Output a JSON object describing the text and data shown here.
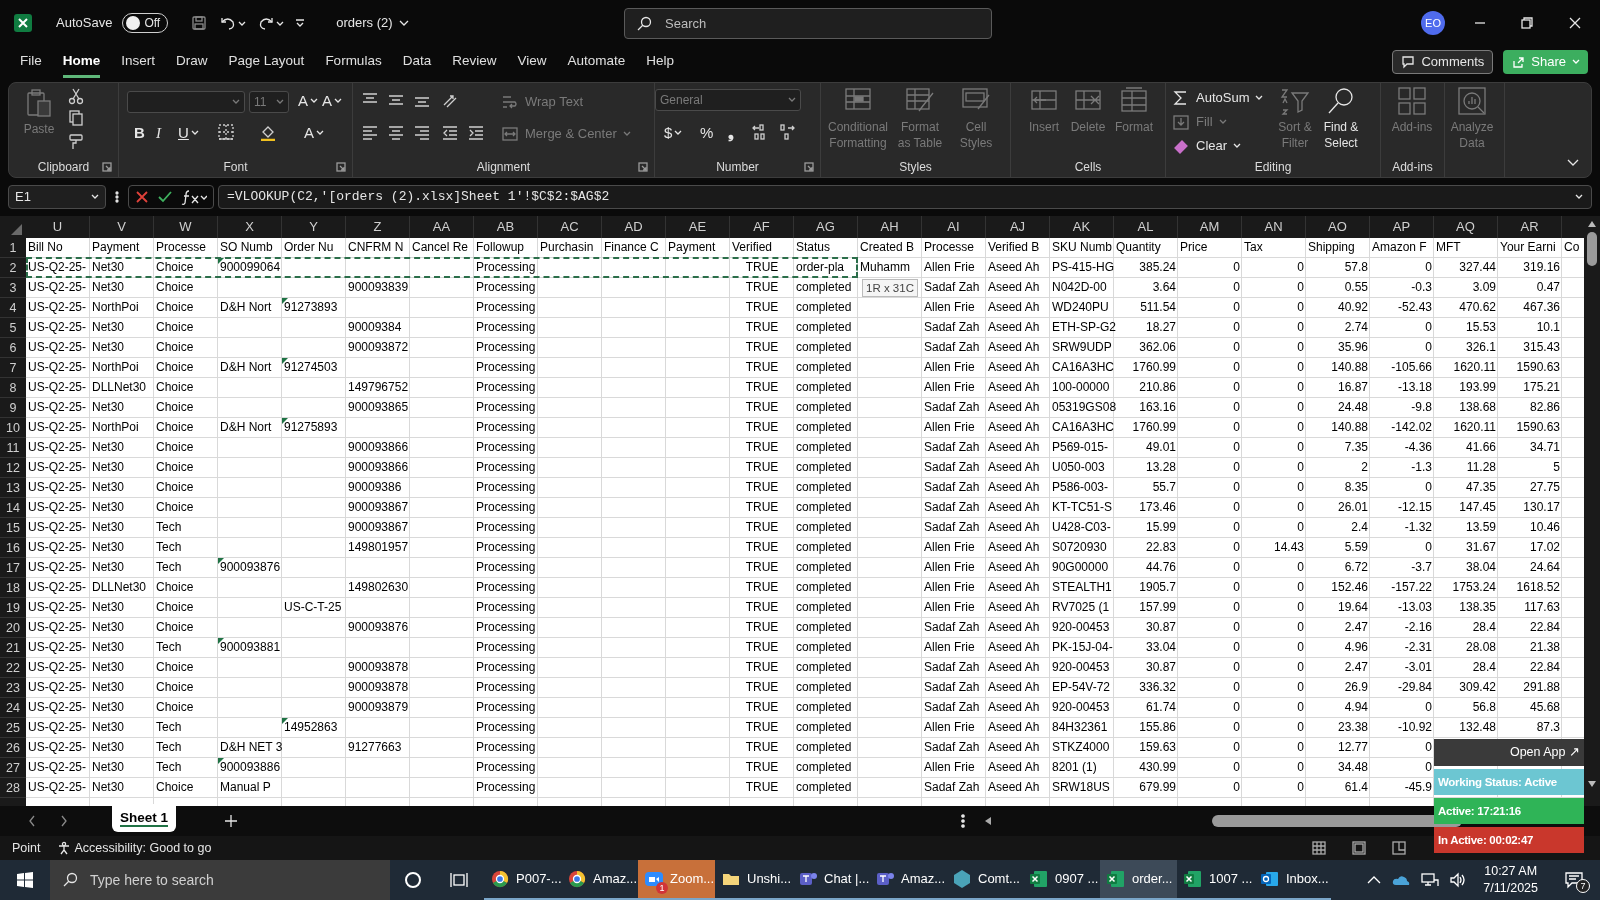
{
  "title_bar": {
    "autosave_label": "AutoSave",
    "autosave": {
      "label": "Off",
      "on": false
    },
    "file_name": "orders (2)",
    "search_placeholder": "Search",
    "avatar": "EO"
  },
  "tabs": [
    {
      "label": "File",
      "selected": false
    },
    {
      "label": "Home",
      "selected": true
    },
    {
      "label": "Insert",
      "selected": false
    },
    {
      "label": "Draw",
      "selected": false
    },
    {
      "label": "Page Layout",
      "selected": false
    },
    {
      "label": "Formulas",
      "selected": false
    },
    {
      "label": "Data",
      "selected": false
    },
    {
      "label": "Review",
      "selected": false
    },
    {
      "label": "View",
      "selected": false
    },
    {
      "label": "Automate",
      "selected": false
    },
    {
      "label": "Help",
      "selected": false
    }
  ],
  "header_buttons": [
    {
      "kind": "comments",
      "label": "Comments"
    },
    {
      "kind": "share",
      "label": "Share"
    }
  ],
  "ribbon": [
    {
      "label": "Clipboard",
      "launcher": true,
      "items": [
        {
          "kind": "paste",
          "label": "Paste",
          "disabled": true
        },
        {
          "kind": "cut"
        },
        {
          "kind": "copy"
        },
        {
          "kind": "painter"
        }
      ]
    },
    {
      "label": "Font",
      "launcher": true,
      "items": [
        {
          "kind": "fontname",
          "disabled": true
        },
        {
          "kind": "fontsize",
          "label": "11",
          "disabled": true
        },
        {
          "kind": "grow",
          "label": "A"
        },
        {
          "kind": "shrink",
          "label": "A"
        },
        {
          "kind": "bold",
          "label": "B"
        },
        {
          "kind": "italic",
          "label": "I"
        },
        {
          "kind": "underline",
          "label": "U"
        },
        {
          "kind": "borders"
        },
        {
          "kind": "fill"
        },
        {
          "kind": "fontcolor",
          "label": "A"
        }
      ]
    },
    {
      "label": "Alignment",
      "launcher": true,
      "items": [
        {
          "kind": "aligntop"
        },
        {
          "kind": "alignmiddle"
        },
        {
          "kind": "alignbottom"
        },
        {
          "kind": "orientation"
        },
        {
          "kind": "wrap",
          "label": "Wrap Text",
          "disabled": true
        },
        {
          "kind": "alignleft"
        },
        {
          "kind": "aligncenter"
        },
        {
          "kind": "alignright"
        },
        {
          "kind": "outdent"
        },
        {
          "kind": "indent"
        },
        {
          "kind": "merge",
          "label": "Merge & Center",
          "disabled": true
        }
      ]
    },
    {
      "label": "Number",
      "launcher": true,
      "items": [
        {
          "kind": "format",
          "label": "General",
          "disabled": true
        },
        {
          "kind": "dollar",
          "label": "$"
        },
        {
          "kind": "percent",
          "label": "%"
        },
        {
          "kind": "comma",
          "label": "❟"
        },
        {
          "kind": "decmore"
        },
        {
          "kind": "decless"
        }
      ]
    },
    {
      "label": "Styles",
      "launcher": false,
      "items": [
        {
          "kind": "conditional",
          "label": "Conditional Formatting",
          "disabled": true
        },
        {
          "kind": "astable",
          "label": "Format as Table",
          "disabled": true
        },
        {
          "kind": "cellstyles",
          "label": "Cell Styles",
          "disabled": true
        }
      ]
    },
    {
      "label": "Cells",
      "launcher": false,
      "items": [
        {
          "kind": "insert",
          "label": "Insert",
          "disabled": true
        },
        {
          "kind": "delete",
          "label": "Delete",
          "disabled": true
        },
        {
          "kind": "cellformat",
          "label": "Format",
          "disabled": true
        }
      ]
    },
    {
      "label": "Editing",
      "launcher": false,
      "items": [
        {
          "kind": "autosum",
          "label": "AutoSum",
          "disabled": false
        },
        {
          "kind": "filldown",
          "label": "Fill",
          "disabled": true
        },
        {
          "kind": "clear",
          "label": "Clear",
          "disabled": false
        },
        {
          "kind": "sort",
          "label": "Sort & Filter",
          "disabled": true
        },
        {
          "kind": "find",
          "label": "Find & Select",
          "disabled": false
        }
      ]
    },
    {
      "label": "Add-ins",
      "launcher": false,
      "items": [
        {
          "kind": "addins",
          "label": "Add-ins",
          "disabled": true
        }
      ]
    },
    {
      "items": [
        {
          "kind": "analyze",
          "label": "Analyze Data",
          "disabled": true
        }
      ]
    }
  ],
  "formula_bar": {
    "name_box": "E1",
    "formula": "=VLOOKUP(C2,'[orders (2).xlsx]Sheet 1'!$C$2:$AG$2"
  },
  "columns": [
    {
      "letter": "U",
      "kind": "text"
    },
    {
      "letter": "V",
      "kind": "text"
    },
    {
      "letter": "W",
      "kind": "text"
    },
    {
      "letter": "X",
      "kind": "text"
    },
    {
      "letter": "Y",
      "kind": "text"
    },
    {
      "letter": "Z",
      "kind": "text"
    },
    {
      "letter": "AA",
      "kind": "text"
    },
    {
      "letter": "AB",
      "kind": "text"
    },
    {
      "letter": "AC",
      "kind": "text"
    },
    {
      "letter": "AD",
      "kind": "text"
    },
    {
      "letter": "AE",
      "kind": "text"
    },
    {
      "letter": "AF",
      "kind": "boolean"
    },
    {
      "letter": "AG",
      "kind": "text"
    },
    {
      "letter": "AH",
      "kind": "text"
    },
    {
      "letter": "AI",
      "kind": "text"
    },
    {
      "letter": "AJ",
      "kind": "text"
    },
    {
      "letter": "AK",
      "kind": "text"
    },
    {
      "letter": "AL",
      "kind": "number"
    },
    {
      "letter": "AM",
      "kind": "number"
    },
    {
      "letter": "AN",
      "kind": "number"
    },
    {
      "letter": "AO",
      "kind": "number"
    },
    {
      "letter": "AP",
      "kind": "number"
    },
    {
      "letter": "AQ",
      "kind": "number"
    },
    {
      "letter": "AR",
      "kind": "number"
    }
  ],
  "rows": [
    {
      "number": "1",
      "kind": "header",
      "copied": false,
      "cells": [
        "Bill No",
        "Payment",
        "Processe",
        "SO Numb",
        "Order Nu",
        "CNFRM N",
        "Cancel Re",
        "Followup",
        "Purchasin",
        "Finance C",
        "Payment",
        "Verified",
        "Status",
        "Created B",
        "Processe",
        "Verified B",
        "SKU Numb",
        "Quantity",
        "Price",
        "Tax",
        "Shipping",
        "Amazon F",
        "MFT",
        "Your Earni",
        "Co"
      ]
    },
    {
      "number": "2",
      "kind": "data",
      "copied": true,
      "cells": [
        "US-Q2-25-",
        "Net30",
        "Choice",
        {
          "text": "900099064",
          "flag": true
        },
        null,
        null,
        null,
        "Processing",
        null,
        null,
        null,
        "TRUE",
        "order-pla",
        "Muhamm",
        "Allen Frie",
        "Aseed Ah",
        "PS-415-HG",
        "385.24",
        "0",
        "0",
        "57.8",
        "0",
        "327.44",
        "319.16"
      ]
    },
    {
      "number": "3",
      "kind": "data",
      "copied": false,
      "cells": [
        "US-Q2-25-",
        "Net30",
        "Choice",
        null,
        null,
        "900093839",
        null,
        "Processing",
        null,
        null,
        null,
        "TRUE",
        "completed",
        null,
        "Sadaf Zah",
        "Aseed Ah",
        "N042D-00",
        "3.64",
        "0",
        "0",
        "0.55",
        "-0.3",
        "3.09",
        "0.47"
      ]
    },
    {
      "number": "4",
      "kind": "data",
      "copied": false,
      "cells": [
        "US-Q2-25-",
        "NorthPoi",
        "Choice",
        "D&H Nort",
        {
          "text": "91273893",
          "flag": true
        },
        null,
        null,
        "Processing",
        null,
        null,
        null,
        "TRUE",
        "completed",
        null,
        "Allen Frie",
        "Aseed Ah",
        "WD240PU",
        "511.54",
        "0",
        "0",
        "40.92",
        "-52.43",
        "470.62",
        "467.36"
      ]
    },
    {
      "number": "5",
      "kind": "data",
      "copied": false,
      "cells": [
        "US-Q2-25-",
        "Net30",
        "Choice",
        null,
        null,
        "90009384",
        null,
        "Processing",
        null,
        null,
        null,
        "TRUE",
        "completed",
        null,
        "Sadaf Zah",
        "Aseed Ah",
        "ETH-SP-G2",
        "18.27",
        "0",
        "0",
        "2.74",
        "0",
        "15.53",
        "10.1"
      ]
    },
    {
      "number": "6",
      "kind": "data",
      "copied": false,
      "cells": [
        "US-Q2-25-",
        "Net30",
        "Choice",
        null,
        null,
        "900093872",
        null,
        "Processing",
        null,
        null,
        null,
        "TRUE",
        "completed",
        null,
        "Sadaf Zah",
        "Aseed Ah",
        "SRW9UDP",
        "362.06",
        "0",
        "0",
        "35.96",
        "0",
        "326.1",
        "315.43"
      ]
    },
    {
      "number": "7",
      "kind": "data",
      "copied": false,
      "cells": [
        "US-Q2-25-",
        "NorthPoi",
        "Choice",
        "D&H Nort",
        {
          "text": "91274503",
          "flag": true
        },
        null,
        null,
        "Processing",
        null,
        null,
        null,
        "TRUE",
        "completed",
        null,
        "Allen Frie",
        "Aseed Ah",
        "CA16A3HC",
        "1760.99",
        "0",
        "0",
        "140.88",
        "-105.66",
        "1620.11",
        "1590.63"
      ]
    },
    {
      "number": "8",
      "kind": "data",
      "copied": false,
      "cells": [
        "US-Q2-25-",
        "DLLNet30",
        "Choice",
        null,
        null,
        "149796752",
        null,
        "Processing",
        null,
        null,
        null,
        "TRUE",
        "completed",
        null,
        "Allen Frie",
        "Aseed Ah",
        "100-00000",
        "210.86",
        "0",
        "0",
        "16.87",
        "-13.18",
        "193.99",
        "175.21"
      ]
    },
    {
      "number": "9",
      "kind": "data",
      "copied": false,
      "cells": [
        "US-Q2-25-",
        "Net30",
        "Choice",
        null,
        null,
        "900093865",
        null,
        "Processing",
        null,
        null,
        null,
        "TRUE",
        "completed",
        null,
        "Sadaf Zah",
        "Aseed Ah",
        "05319GS08",
        "163.16",
        "0",
        "0",
        "24.48",
        "-9.8",
        "138.68",
        "82.86"
      ]
    },
    {
      "number": "10",
      "kind": "data",
      "copied": false,
      "cells": [
        "US-Q2-25-",
        "NorthPoi",
        "Choice",
        "D&H Nort",
        {
          "text": "91275893",
          "flag": true
        },
        null,
        null,
        "Processing",
        null,
        null,
        null,
        "TRUE",
        "completed",
        null,
        "Allen Frie",
        "Aseed Ah",
        "CA16A3HC",
        "1760.99",
        "0",
        "0",
        "140.88",
        "-142.02",
        "1620.11",
        "1590.63"
      ]
    },
    {
      "number": "11",
      "kind": "data",
      "copied": false,
      "cells": [
        "US-Q2-25-",
        "Net30",
        "Choice",
        null,
        null,
        "900093866",
        null,
        "Processing",
        null,
        null,
        null,
        "TRUE",
        "completed",
        null,
        "Sadaf Zah",
        "Aseed Ah",
        "P569-015-",
        "49.01",
        "0",
        "0",
        "7.35",
        "-4.36",
        "41.66",
        "34.71"
      ]
    },
    {
      "number": "12",
      "kind": "data",
      "copied": false,
      "cells": [
        "US-Q2-25-",
        "Net30",
        "Choice",
        null,
        null,
        "900093866",
        null,
        "Processing",
        null,
        null,
        null,
        "TRUE",
        "completed",
        null,
        "Sadaf Zah",
        "Aseed Ah",
        "U050-003",
        "13.28",
        "0",
        "0",
        "2",
        "-1.3",
        "11.28",
        "5"
      ]
    },
    {
      "number": "13",
      "kind": "data",
      "copied": false,
      "cells": [
        "US-Q2-25-",
        "Net30",
        "Choice",
        null,
        null,
        "90009386",
        null,
        "Processing",
        null,
        null,
        null,
        "TRUE",
        "completed",
        null,
        "Sadaf Zah",
        "Aseed Ah",
        "P586-003-",
        "55.7",
        "0",
        "0",
        "8.35",
        "0",
        "47.35",
        "27.75"
      ]
    },
    {
      "number": "14",
      "kind": "data",
      "copied": false,
      "cells": [
        "US-Q2-25-",
        "Net30",
        "Choice",
        null,
        null,
        "900093867",
        null,
        "Processing",
        null,
        null,
        null,
        "TRUE",
        "completed",
        null,
        "Sadaf Zah",
        "Aseed Ah",
        "KT-TC51-S",
        "173.46",
        "0",
        "0",
        "26.01",
        "-12.15",
        "147.45",
        "130.17"
      ]
    },
    {
      "number": "15",
      "kind": "data",
      "copied": false,
      "cells": [
        "US-Q2-25-",
        "Net30",
        "Tech",
        null,
        null,
        "900093867",
        null,
        "Processing",
        null,
        null,
        null,
        "TRUE",
        "completed",
        null,
        "Sadaf Zah",
        "Aseed Ah",
        "U428-C03-",
        "15.99",
        "0",
        "0",
        "2.4",
        "-1.32",
        "13.59",
        "10.46"
      ]
    },
    {
      "number": "16",
      "kind": "data",
      "copied": false,
      "cells": [
        "US-Q2-25-",
        "Net30",
        "Tech",
        null,
        null,
        "149801957",
        null,
        "Processing",
        null,
        null,
        null,
        "TRUE",
        "completed",
        null,
        "Allen Frie",
        "Aseed Ah",
        "S0720930",
        "22.83",
        "0",
        "14.43",
        "5.59",
        "0",
        "31.67",
        "17.02"
      ]
    },
    {
      "number": "17",
      "kind": "data",
      "copied": false,
      "cells": [
        "US-Q2-25-",
        "Net30",
        "Tech",
        {
          "text": "900093876",
          "flag": true
        },
        null,
        null,
        null,
        "Processing",
        null,
        null,
        null,
        "TRUE",
        "completed",
        null,
        "Allen Frie",
        "Aseed Ah",
        "90G00000",
        "44.76",
        "0",
        "0",
        "6.72",
        "-3.7",
        "38.04",
        "24.64"
      ]
    },
    {
      "number": "18",
      "kind": "data",
      "copied": false,
      "cells": [
        "US-Q2-25-",
        "DLLNet30",
        "Choice",
        null,
        null,
        "149802630",
        null,
        "Processing",
        null,
        null,
        null,
        "TRUE",
        "completed",
        null,
        "Allen Frie",
        "Aseed Ah",
        "STEALTH1",
        "1905.7",
        "0",
        "0",
        "152.46",
        "-157.22",
        "1753.24",
        "1618.52"
      ]
    },
    {
      "number": "19",
      "kind": "data",
      "copied": false,
      "cells": [
        "US-Q2-25-",
        "Net30",
        "Choice",
        null,
        "US-C-T-25",
        null,
        null,
        "Processing",
        null,
        null,
        null,
        "TRUE",
        "completed",
        null,
        "Allen Frie",
        "Aseed Ah",
        "RV7025 (1",
        "157.99",
        "0",
        "0",
        "19.64",
        "-13.03",
        "138.35",
        "117.63"
      ]
    },
    {
      "number": "20",
      "kind": "data",
      "copied": false,
      "cells": [
        "US-Q2-25-",
        "Net30",
        "Choice",
        null,
        null,
        "900093876",
        null,
        "Processing",
        null,
        null,
        null,
        "TRUE",
        "completed",
        null,
        "Sadaf Zah",
        "Aseed Ah",
        "920-00453",
        "30.87",
        "0",
        "0",
        "2.47",
        "-2.16",
        "28.4",
        "22.84"
      ]
    },
    {
      "number": "21",
      "kind": "data",
      "copied": false,
      "cells": [
        "US-Q2-25-",
        "Net30",
        "Tech",
        {
          "text": "900093881",
          "flag": true
        },
        null,
        null,
        null,
        "Processing",
        null,
        null,
        null,
        "TRUE",
        "completed",
        null,
        "Allen Frie",
        "Aseed Ah",
        "PK-15J-04-",
        "33.04",
        "0",
        "0",
        "4.96",
        "-2.31",
        "28.08",
        "21.38"
      ]
    },
    {
      "number": "22",
      "kind": "data",
      "copied": false,
      "cells": [
        "US-Q2-25-",
        "Net30",
        "Choice",
        null,
        null,
        "900093878",
        null,
        "Processing",
        null,
        null,
        null,
        "TRUE",
        "completed",
        null,
        "Sadaf Zah",
        "Aseed Ah",
        "920-00453",
        "30.87",
        "0",
        "0",
        "2.47",
        "-3.01",
        "28.4",
        "22.84"
      ]
    },
    {
      "number": "23",
      "kind": "data",
      "copied": false,
      "cells": [
        "US-Q2-25-",
        "Net30",
        "Choice",
        null,
        null,
        "900093878",
        null,
        "Processing",
        null,
        null,
        null,
        "TRUE",
        "completed",
        null,
        "Sadaf Zah",
        "Aseed Ah",
        "EP-54V-72",
        "336.32",
        "0",
        "0",
        "26.9",
        "-29.84",
        "309.42",
        "291.88"
      ]
    },
    {
      "number": "24",
      "kind": "data",
      "copied": false,
      "cells": [
        "US-Q2-25-",
        "Net30",
        "Choice",
        null,
        null,
        "900093879",
        null,
        "Processing",
        null,
        null,
        null,
        "TRUE",
        "completed",
        null,
        "Sadaf Zah",
        "Aseed Ah",
        "920-00453",
        "61.74",
        "0",
        "0",
        "4.94",
        "0",
        "56.8",
        "45.68"
      ]
    },
    {
      "number": "25",
      "kind": "data",
      "copied": false,
      "cells": [
        "US-Q2-25-",
        "Net30",
        "Tech",
        null,
        {
          "text": "14952863",
          "flag": true
        },
        null,
        null,
        "Processing",
        null,
        null,
        null,
        "TRUE",
        "completed",
        null,
        "Allen Frie",
        "Aseed Ah",
        "84H32361",
        "155.86",
        "0",
        "0",
        "23.38",
        "-10.92",
        "132.48",
        "87.3"
      ]
    },
    {
      "number": "26",
      "kind": "data",
      "copied": false,
      "cells": [
        "US-Q2-25-",
        "Net30",
        "Tech",
        "D&H NET 3",
        null,
        "91277663",
        null,
        "Processing",
        null,
        null,
        null,
        "TRUE",
        "completed",
        null,
        "Sadaf Zah",
        "Aseed Ah",
        "STKZ4000",
        "159.63",
        "0",
        "0",
        "12.77",
        "0",
        null,
        null
      ]
    },
    {
      "number": "27",
      "kind": "data",
      "copied": false,
      "cells": [
        "US-Q2-25-",
        "Net30",
        "Tech",
        {
          "text": "900093886",
          "flag": true
        },
        null,
        null,
        null,
        "Processing",
        null,
        null,
        null,
        "TRUE",
        "completed",
        null,
        "Allen Frie",
        "Aseed Ah",
        "8201 (1)",
        "430.99",
        "0",
        "0",
        "34.48",
        "0",
        null,
        null
      ]
    },
    {
      "number": "28",
      "kind": "data",
      "copied": false,
      "cells": [
        "US-Q2-25-",
        "Net30",
        "Choice",
        "Manual P",
        null,
        null,
        null,
        "Processing",
        null,
        null,
        null,
        "TRUE",
        "completed",
        null,
        "Sadaf Zah",
        "Aseed Ah",
        "SRW18US",
        "679.99",
        "0",
        "0",
        "61.4",
        "-45.9",
        null,
        null
      ]
    }
  ],
  "selection_tooltip": "1R x 31C",
  "sheet_tabs": [
    {
      "label": "Sheet 1",
      "selected": true
    }
  ],
  "status_bar": {
    "mode": "Point",
    "accessibility": "Accessibility: Good to go"
  },
  "tracker": {
    "open_app": "Open App ↗",
    "statuses": [
      {
        "label": "Working Status: Active",
        "color": "#6cc6d2"
      },
      {
        "label": "Active: 17:21:16",
        "color": "#2fb457"
      },
      {
        "label": "In Active: 00:02:47",
        "color": "#c9372c"
      }
    ]
  },
  "taskbar": {
    "search_placeholder": "Type here to search",
    "apps": [
      {
        "label": "P007-...",
        "kind": "chrome",
        "selected": false
      },
      {
        "label": "Amaz...",
        "kind": "chrome",
        "selected": false
      },
      {
        "label": "Zoom...",
        "kind": "zoom",
        "selected": false,
        "badge": "1"
      },
      {
        "label": "Unshi...",
        "kind": "folder",
        "selected": false
      },
      {
        "label": "Chat |...",
        "kind": "teams",
        "selected": false
      },
      {
        "label": "Amaz...",
        "kind": "teams",
        "selected": false
      },
      {
        "label": "Comt...",
        "kind": "hex",
        "selected": false
      },
      {
        "label": "0907 ...",
        "kind": "excel",
        "selected": false
      },
      {
        "label": "order...",
        "kind": "excel",
        "selected": true
      },
      {
        "label": "1007 ...",
        "kind": "excel",
        "selected": false
      },
      {
        "label": "Inbox...",
        "kind": "outlook",
        "selected": false
      }
    ],
    "time": "10:27 AM",
    "date": "7/11/2025",
    "notifications": "7"
  }
}
